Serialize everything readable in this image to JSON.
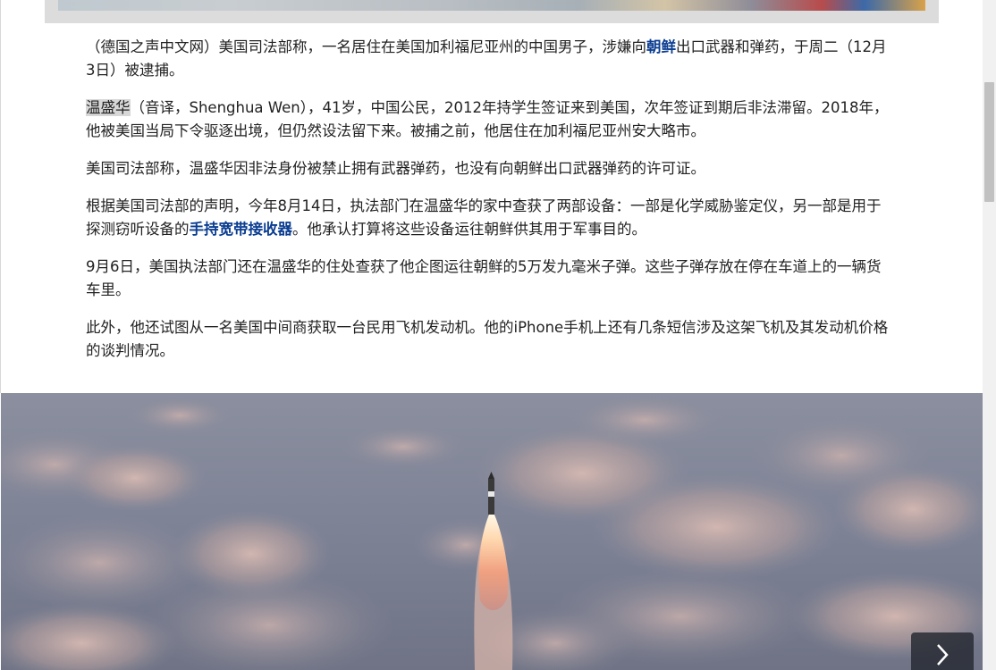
{
  "article": {
    "p1": {
      "before": "（德国之声中文网）美国司法部称，一名居住在美国加利福尼亚州的中国男子，涉嫌向",
      "link": "朝鲜",
      "after": "出口武器和弹药，于周二（12月3日）被逮捕。"
    },
    "p2": {
      "highlight": "温盛华",
      "rest": "（音译，Shenghua Wen），41岁，中国公民，2012年持学生签证来到美国，次年签证到期后非法滞留。2018年，他被美国当局下令驱逐出境，但仍然设法留下来。被捕之前，他居住在加利福尼亚州安大略市。"
    },
    "p3": "美国司法部称，温盛华因非法身份被禁止拥有武器弹药，也没有向朝鲜出口武器弹药的许可证。",
    "p4": {
      "before": "根据美国司法部的声明，今年8月14日，执法部门在温盛华的家中查获了两部设备：一部是化学威胁鉴定仪，另一部是用于探测窃听设备的",
      "link": "手持宽带接收器",
      "after": "。他承认打算将这些设备运往朝鲜供其用于军事目的。"
    },
    "p5": "9月6日，美国执法部门还在温盛华的住处查获了他企图运往朝鲜的5万发九毫米子弹。这些子弹存放在停在车道上的一辆货车里。",
    "p6": "此外，他还试图从一名美国中间商获取一台民用飞机发动机。他的iPhone手机上还有几条短信涉及这架飞机及其发动机价格的谈判情况。"
  },
  "gallery": {
    "next_icon": "chevron-right-icon"
  },
  "colors": {
    "link": "#0b3d91",
    "text": "#222222",
    "highlight": "#d7d7d7"
  }
}
